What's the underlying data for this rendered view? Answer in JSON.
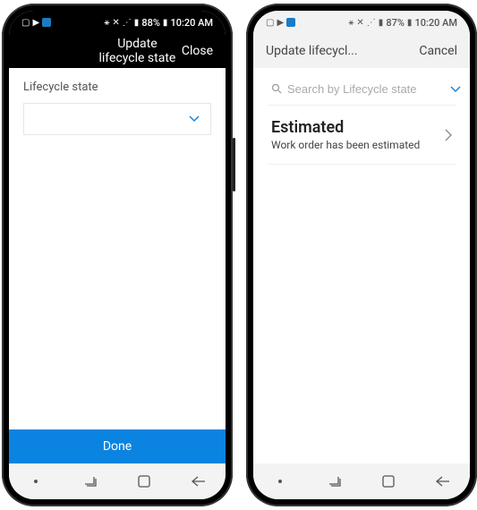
{
  "phone1": {
    "status": {
      "battery": "88%",
      "time": "10:20 AM"
    },
    "appbar": {
      "title": "Update lifecycle state",
      "close": "Close"
    },
    "field": {
      "label": "Lifecycle state",
      "value": ""
    },
    "done": "Done"
  },
  "phone2": {
    "status": {
      "battery": "87%",
      "time": "10:20 AM"
    },
    "appbar": {
      "title": "Update lifecycl...",
      "cancel": "Cancel"
    },
    "search": {
      "placeholder": "Search by Lifecycle state"
    },
    "option": {
      "title": "Estimated",
      "subtitle": "Work order has been estimated"
    }
  },
  "colors": {
    "accent": "#0a84e0"
  }
}
